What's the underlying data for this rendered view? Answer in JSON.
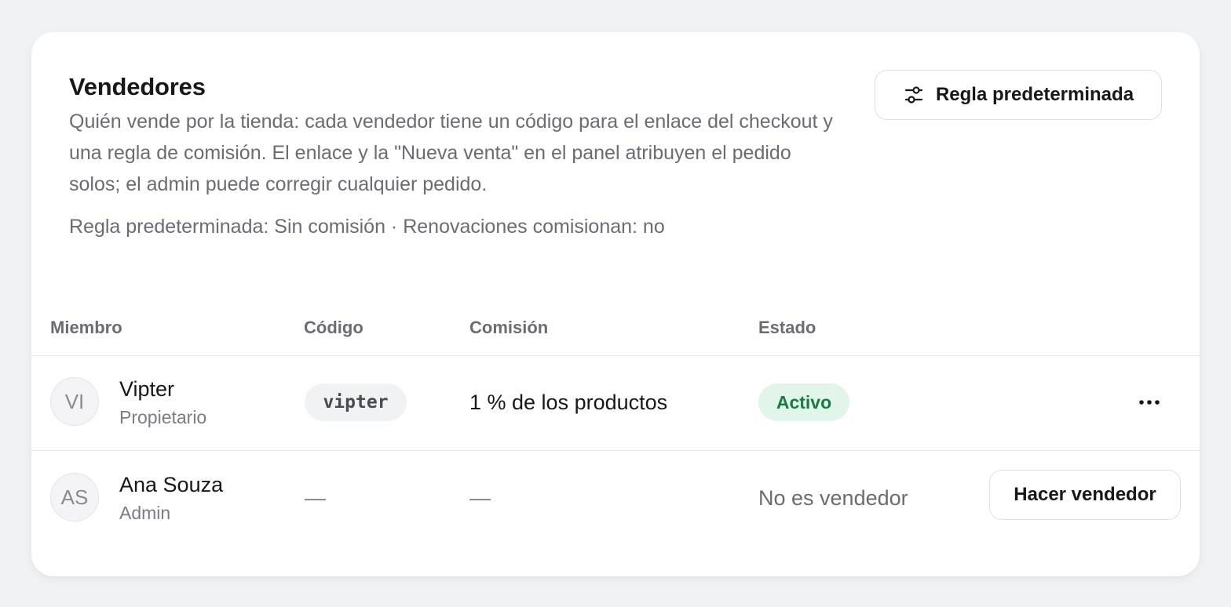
{
  "header": {
    "title": "Vendedores",
    "description": "Quién vende por la tienda: cada vendedor tiene un código para el enlace del checkout y una regla de comisión. El enlace y la \"Nueva venta\" en el panel atribuyen el pedido solos; el admin puede corregir cualquier pedido.",
    "rule_summary": "Regla predeterminada: Sin comisión · Renovaciones comisionan: no",
    "rule_button_label": "Regla predeterminada",
    "rule_button_icon": "sliders-icon"
  },
  "table": {
    "columns": [
      "Miembro",
      "Código",
      "Comisión",
      "Estado"
    ],
    "rows": [
      {
        "initials": "VI",
        "name": "Vipter",
        "role": "Propietario",
        "code": "vipter",
        "commission": "1 % de los productos",
        "status": "Activo",
        "action_icon": "more-horizontal-icon"
      },
      {
        "initials": "AS",
        "name": "Ana Souza",
        "role": "Admin",
        "code": "—",
        "commission": "—",
        "status": "No es vendedor",
        "action_label": "Hacer vendedor"
      }
    ]
  },
  "colors": {
    "active_badge_bg": "#e2f5ea",
    "active_badge_text": "#1a7a45",
    "muted_text": "#6b6b73"
  }
}
